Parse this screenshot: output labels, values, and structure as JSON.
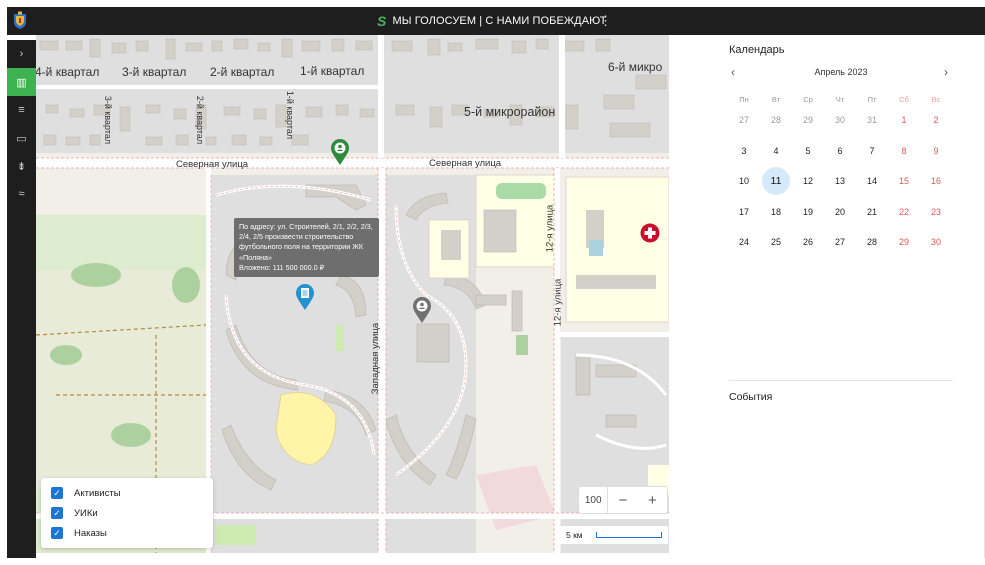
{
  "topbar": {
    "title": "МЫ ГОЛОСУЕМ | С НАМИ ПОБЕЖДАЮТ",
    "logo_icon": "coat-of-arms-icon",
    "menu_icon": "kebab-menu-icon"
  },
  "rail": {
    "items": [
      {
        "icon": "chevron-right-icon",
        "glyph": "›",
        "active": false
      },
      {
        "icon": "map-icon",
        "glyph": "▥",
        "active": true
      },
      {
        "icon": "list-icon",
        "glyph": "≡",
        "active": false
      },
      {
        "icon": "card-icon",
        "glyph": "▭",
        "active": false
      },
      {
        "icon": "filter-icon",
        "glyph": "⇟",
        "active": false
      },
      {
        "icon": "route-icon",
        "glyph": "≈",
        "active": false
      }
    ]
  },
  "map": {
    "labels": {
      "kv4": "4-й квартал",
      "kv3": "3-й квартал",
      "kv2": "2-й квартал",
      "kv1": "1-й квартал",
      "mkr6": "6-й микро",
      "mkr5": "5-й микрорайон",
      "severnaya1": "Северная улица",
      "severnaya2": "Северная улица",
      "zapadnaya": "Западная улица",
      "ul12": "12-я улица",
      "ul12b": "12-я улица",
      "v3kv": "3-й квартал",
      "v2kv": "2-й квартал",
      "v1kv": "1-й квартал"
    },
    "tooltip": {
      "text": "По адресу: ул. Строителей, 2/1, 2/2, 2/3, 2/4, 2/5 произвести строительство футбольного поля на территории ЖК «Поляна»",
      "invested": "Вложено: 111 500 000.0 ₽"
    },
    "markers": [
      {
        "icon": "activist-marker-icon",
        "color": "#2e8b3e"
      },
      {
        "icon": "order-marker-icon",
        "color": "#2592d0"
      },
      {
        "icon": "uik-marker-icon",
        "color": "#707070"
      },
      {
        "icon": "hospital-icon",
        "color": "#c8102e"
      }
    ],
    "layers": [
      {
        "label": "Активисты",
        "checked": true
      },
      {
        "label": "УИКи",
        "checked": true
      },
      {
        "label": "Наказы",
        "checked": true
      }
    ],
    "zoom": {
      "value": "100",
      "minus": "−",
      "plus": "+"
    },
    "scale": "5 км"
  },
  "calendar": {
    "title": "Календарь",
    "prev": "‹",
    "next": "›",
    "month": "Апрель 2023",
    "weekdays": [
      "Пн",
      "Вт",
      "Ср",
      "Чт",
      "Пт",
      "Сб",
      "Вс"
    ],
    "weeks": [
      [
        "27",
        "28",
        "29",
        "30",
        "31",
        "1",
        "2"
      ],
      [
        "3",
        "4",
        "5",
        "6",
        "7",
        "8",
        "9"
      ],
      [
        "10",
        "11",
        "12",
        "13",
        "14",
        "15",
        "16"
      ],
      [
        "17",
        "18",
        "19",
        "20",
        "21",
        "22",
        "23"
      ],
      [
        "24",
        "25",
        "26",
        "27",
        "28",
        "29",
        "30"
      ]
    ],
    "muted": [
      [
        0,
        0
      ],
      [
        0,
        1
      ],
      [
        0,
        2
      ],
      [
        0,
        3
      ],
      [
        0,
        4
      ]
    ],
    "today": [
      2,
      1
    ]
  },
  "events": {
    "title": "События"
  },
  "colors": {
    "accent": "#3eb24f",
    "today_bg": "#d6e9f8",
    "weekend": "#e05555",
    "topbar": "#1e1e1e"
  }
}
